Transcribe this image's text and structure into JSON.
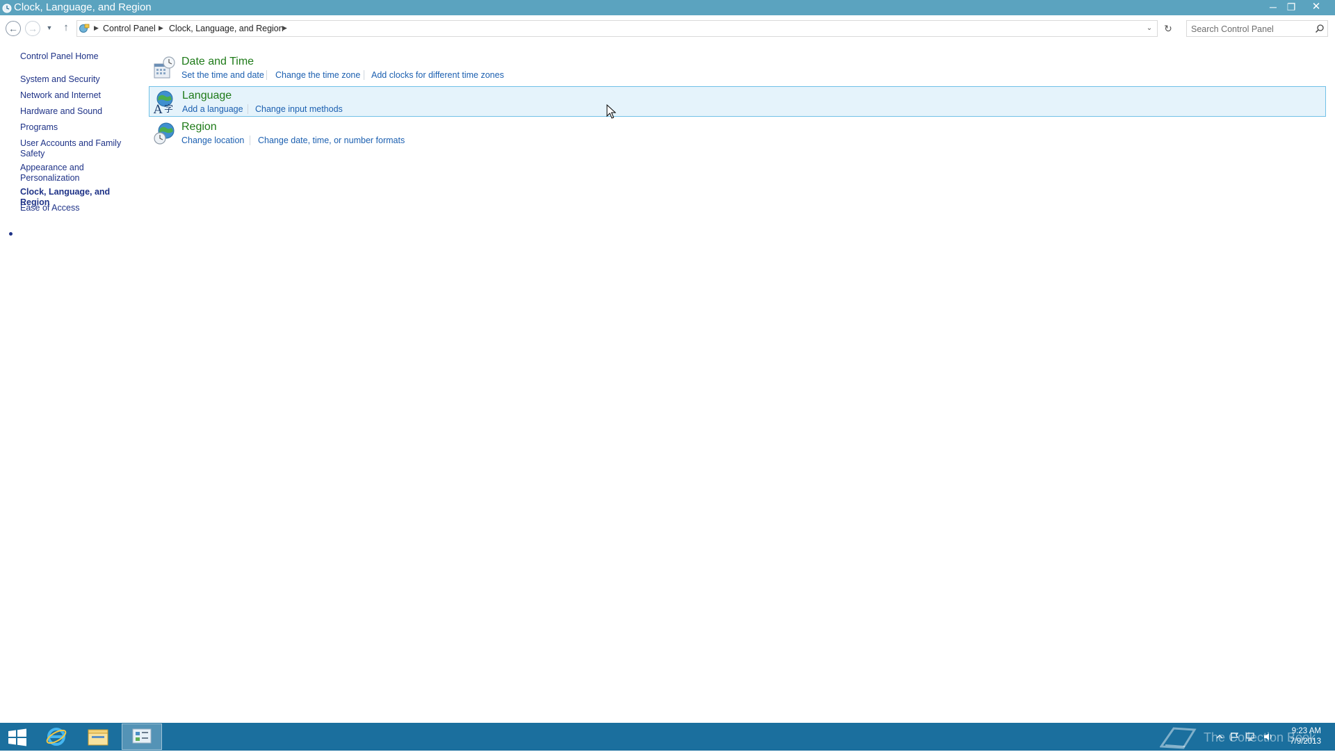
{
  "window": {
    "title": "Clock, Language, and Region",
    "controls": {
      "minimize": "─",
      "restore": "❐",
      "close": "✕"
    }
  },
  "nav": {
    "back_icon": "back-arrow-icon",
    "forward_icon": "forward-arrow-icon",
    "recent_icon": "chevron-down-icon",
    "up_icon": "up-arrow-icon",
    "breadcrumb": [
      "Control Panel",
      "Clock, Language, and Region"
    ],
    "search_placeholder": "Search Control Panel"
  },
  "sidebar": {
    "home": "Control Panel Home",
    "items": [
      {
        "label": "System and Security"
      },
      {
        "label": "Network and Internet"
      },
      {
        "label": "Hardware and Sound"
      },
      {
        "label": "Programs"
      },
      {
        "label": "User Accounts and Family Safety"
      },
      {
        "label": "Appearance and Personalization"
      },
      {
        "label": "Clock, Language, and Region",
        "current": true
      },
      {
        "label": "Ease of Access"
      }
    ]
  },
  "categories": [
    {
      "title": "Date and Time",
      "icon": "date-time-icon",
      "tasks": [
        "Set the time and date",
        "Change the time zone",
        "Add clocks for different time zones"
      ]
    },
    {
      "title": "Language",
      "icon": "language-icon",
      "hover": true,
      "tasks": [
        "Add a language",
        "Change input methods"
      ]
    },
    {
      "title": "Region",
      "icon": "region-globe-icon",
      "tasks": [
        "Change location",
        "Change date, time, or number formats"
      ]
    }
  ],
  "taskbar": {
    "clock_time": "9:23 AM",
    "clock_date": "7/9/2013",
    "watermark": "The Collection Book"
  },
  "colors": {
    "titlebar": "#5ba3bf",
    "taskbar": "#1b6f9e",
    "category_title": "#1e7a18",
    "task_link": "#1b5fb0",
    "sidebar_link": "#1e3287",
    "hover_bg": "#e5f3fb",
    "hover_border": "#70c0e7"
  }
}
